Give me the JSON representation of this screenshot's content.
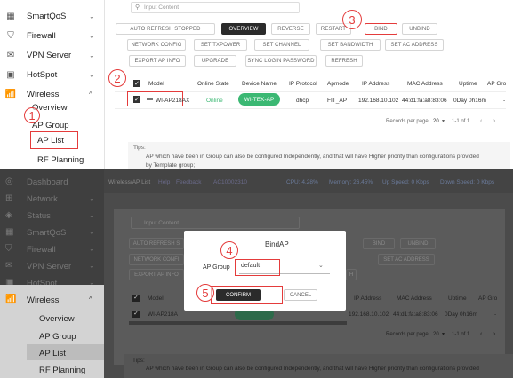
{
  "top": {
    "sidebar": [
      {
        "icon": "grid-icon",
        "label": "SmartQoS",
        "chevron": "⌄"
      },
      {
        "icon": "shield-icon",
        "label": "Firewall",
        "chevron": "⌄"
      },
      {
        "icon": "mail-icon",
        "label": "VPN Server",
        "chevron": "⌄"
      },
      {
        "icon": "hotspot-icon",
        "label": "HotSpot",
        "chevron": "⌄"
      },
      {
        "icon": "wifi-icon",
        "label": "Wireless",
        "chevron": "^"
      }
    ],
    "submenu": [
      "Overview",
      "AP Group",
      "AP List",
      "RF Planning"
    ],
    "search_placeholder": "Input Content",
    "toolbar_row1": [
      "AUTO REFRESH STOPPED",
      "OVERVIEW",
      "REVERSE",
      "RESTART",
      "BIND",
      "UNBIND"
    ],
    "toolbar_row2": [
      "NETWORK CONFIG",
      "SET TXPOWER",
      "SET CHANNEL",
      "SET BANDWIDTH",
      "SET AC ADDRESS"
    ],
    "toolbar_row3": [
      "EXPORT AP INFO",
      "UPGRADE",
      "SYNC LOGIN PASSWORD",
      "REFRESH"
    ],
    "table_headers": [
      "Model",
      "Online State",
      "Device Name",
      "IP Protocol",
      "Apmode",
      "IP Address",
      "MAC Address",
      "Uptime",
      "AP Gro"
    ],
    "row": {
      "model": "WI-AP218AX",
      "online": "Online",
      "device": "WI-TEK-AP",
      "protocol": "dhcp",
      "apmode": "FIT_AP",
      "ip": "192.168.10.102",
      "mac": "44:d1:fa:a8:83:06",
      "uptime": "0Day 0h16m",
      "group": "-"
    },
    "pager": "Records per page:",
    "pager_count": "20",
    "pager_range": "1-1 of 1",
    "tips_title": "Tips:",
    "tips_text": "AP which have been in Group can also be configured Independently, and that will have Higher priority than configurations provided",
    "tips_text2": "by Template group;"
  },
  "bottom": {
    "topbar_title": "Wireless/AP List",
    "help": "Help",
    "feedback": "Feedback",
    "ac": "AC10002310",
    "cpu": "CPU: 4.28%",
    "memory": "Memory: 26.45%",
    "up": "Up Speed: 0 Kbps",
    "down": "Down Speed: 0 Kbps",
    "sidebar": [
      {
        "icon": "dashboard-icon",
        "label": "Dashboard",
        "chevron": ""
      },
      {
        "icon": "network-icon",
        "label": "Network",
        "chevron": "⌄"
      },
      {
        "icon": "status-icon",
        "label": "Status",
        "chevron": "⌄"
      },
      {
        "icon": "grid-icon",
        "label": "SmartQoS",
        "chevron": "⌄"
      },
      {
        "icon": "shield-icon",
        "label": "Firewall",
        "chevron": "⌄"
      },
      {
        "icon": "mail-icon",
        "label": "VPN Server",
        "chevron": "⌄"
      },
      {
        "icon": "hotspot-icon",
        "label": "HotSpot",
        "chevron": "⌄"
      },
      {
        "icon": "wifi-icon",
        "label": "Wireless",
        "chevron": "^"
      }
    ],
    "submenu": [
      "Overview",
      "AP Group",
      "AP List",
      "RF Planning"
    ],
    "search_placeholder": "Input Content",
    "row1": [
      "AUTO REFRESH S",
      "BIND",
      "UNBIND"
    ],
    "row2": [
      "NETWORK CONFI",
      "SET AC ADDRESS"
    ],
    "row3": [
      "EXPORT AP INFO",
      "H"
    ],
    "headers": [
      "Model",
      "IP Address",
      "MAC Address",
      "Uptime",
      "AP Gro"
    ],
    "row": {
      "model": "WI-AP218A",
      "ip": "192.168.10.102",
      "mac": "44:d1:fa:a8:83:06",
      "uptime": "0Day 0h16m",
      "group": "-"
    },
    "pager": "Records per page:",
    "pager_count": "20",
    "pager_range": "1-1 of 1",
    "tips_title": "Tips:",
    "tips_text": "AP which have been in Group can also be configured Independently, and that will have Higher priority than configurations provided"
  },
  "dialog": {
    "title": "BindAP",
    "field_label": "AP Group",
    "field_value": "default",
    "confirm": "CONFIRM",
    "cancel": "CANCEL"
  },
  "steps": [
    "1",
    "2",
    "3",
    "4",
    "5"
  ],
  "colors": {
    "accent_red": "#e43b3b",
    "online_green": "#3bb873"
  }
}
